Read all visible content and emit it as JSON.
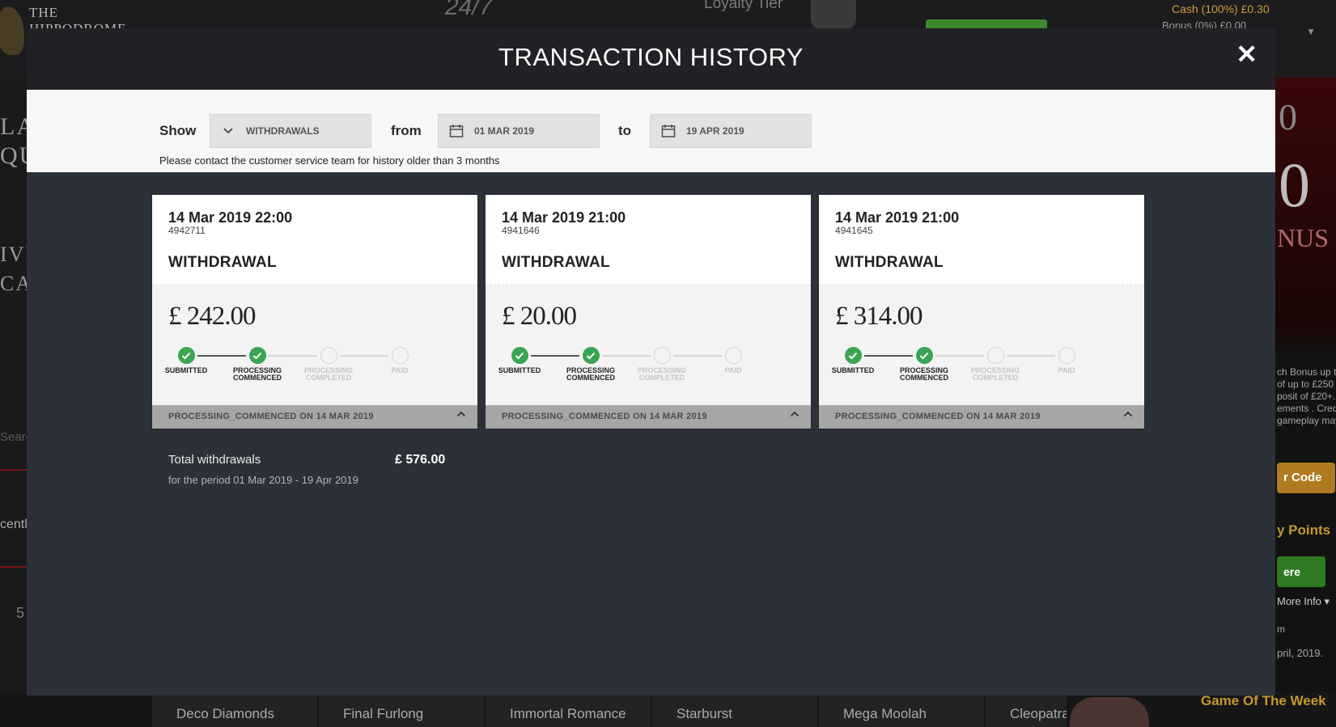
{
  "background": {
    "logo": [
      "THE",
      "HIPPODROME"
    ],
    "support": "24/7",
    "loyalty": "Loyalty Tier",
    "cash": "Cash (100%) £0.30",
    "bonus": "Bonus (0%) £0.00",
    "left_texts": [
      "LA",
      "QU",
      "IVE",
      "CAS"
    ],
    "search": "Search",
    "recent": "centl",
    "five": "5",
    "right_big": [
      "0",
      "0",
      "NUS"
    ],
    "right_bonus_text": [
      "ch Bonus up to",
      "of up to £250",
      "posit of £20+.",
      "ements . Credit",
      "gameplay may"
    ],
    "promo_code": "r Code",
    "points": "y Points",
    "here": "ere",
    "more_info": "More Info",
    "m_text": "m",
    "april": "pril, 2019.",
    "games": [
      "Deco Diamonds",
      "Final Furlong",
      "Immortal Romance",
      "Starburst",
      "Mega Moolah",
      "Cleopatra"
    ],
    "game_of_week": "Game Of The Week"
  },
  "modal": {
    "title": "TRANSACTION HISTORY",
    "close_icon": "close-icon"
  },
  "filters": {
    "show_label": "Show",
    "type_value": "WITHDRAWALS",
    "from_label": "from",
    "from_value": "01 MAR 2019",
    "to_label": "to",
    "to_value": "19 APR 2019",
    "notice": "Please contact the customer service team for history older than 3 months"
  },
  "transactions": [
    {
      "date": "14 Mar 2019 22:00",
      "id": "4942711",
      "type": "WITHDRAWAL",
      "amount": "£ 242.00",
      "status": "PROCESSING_COMMENCED ON 14 MAR 2019"
    },
    {
      "date": "14 Mar 2019 21:00",
      "id": "4941646",
      "type": "WITHDRAWAL",
      "amount": "£ 20.00",
      "status": "PROCESSING_COMMENCED ON 14 MAR 2019"
    },
    {
      "date": "14 Mar 2019 21:00",
      "id": "4941645",
      "type": "WITHDRAWAL",
      "amount": "£ 314.00",
      "status": "PROCESSING_COMMENCED ON 14 MAR 2019"
    }
  ],
  "steps": [
    {
      "label1": "SUBMITTED",
      "label2": "",
      "done": true
    },
    {
      "label1": "PROCESSING",
      "label2": "COMMENCED",
      "done": true
    },
    {
      "label1": "PROCESSING",
      "label2": "COMPLETED",
      "done": false
    },
    {
      "label1": "PAID",
      "label2": "",
      "done": false
    }
  ],
  "totals": {
    "label": "Total withdrawals",
    "value": "£ 576.00",
    "period": "for the period 01 Mar 2019 - 19 Apr 2019"
  },
  "colors": {
    "modal_bg": "#2c3038",
    "header_bg": "#202225",
    "success": "#3aa452",
    "status_bar": "#a6a6a6"
  }
}
